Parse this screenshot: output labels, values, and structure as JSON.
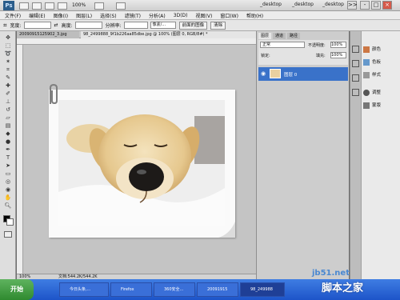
{
  "titlebar": {
    "app_logo": "Ps",
    "zoom": "100%",
    "workspace_buttons": [
      "_desktop",
      "_desktop",
      "_desktop"
    ],
    "window_buttons": [
      ">>",
      "-",
      "□",
      "×"
    ]
  },
  "menu": [
    "文件(F)",
    "编辑(E)",
    "图像(I)",
    "图层(L)",
    "选择(S)",
    "滤镜(T)",
    "分析(A)",
    "3D(D)",
    "视图(V)",
    "窗口(W)",
    "帮助(H)"
  ],
  "options": {
    "width_label": "宽度:",
    "height_label": "高度:",
    "resolution_label": "分辨率:",
    "unit_label": "像素/...",
    "front_image_button": "前面的图像",
    "clear_button": "清除"
  },
  "document": {
    "tabs": [
      "20090915125902_3.jpg",
      "98_2499888_9f1b226aa85dbe.jpg @ 100% (图层 0, RGB/8#) *"
    ],
    "zoom_status": "100%",
    "doc_status": "文档:544.2K/544.2K"
  },
  "layers_panel": {
    "tabs": [
      "图层",
      "通道",
      "路径"
    ],
    "blend_mode": "正常",
    "opacity_label": "不透明度:",
    "opacity_value": "100%",
    "lock_label": "锁定:",
    "fill_label": "填充:",
    "fill_value": "100%",
    "layer_name": "图层 0"
  },
  "side_panel": {
    "items": [
      "颜色",
      "色板",
      "样式",
      "调整",
      "蒙版"
    ]
  },
  "taskbar": {
    "start_label": "开始",
    "buttons": [
      "今日头条,...",
      "Firefox",
      "360安全...",
      "20091915",
      "98_249988"
    ]
  },
  "watermark": {
    "site": "jb51.net",
    "text": "脚本之家"
  },
  "colors": {
    "accent": "#3a72c9",
    "taskbar": "#1d54c9"
  }
}
